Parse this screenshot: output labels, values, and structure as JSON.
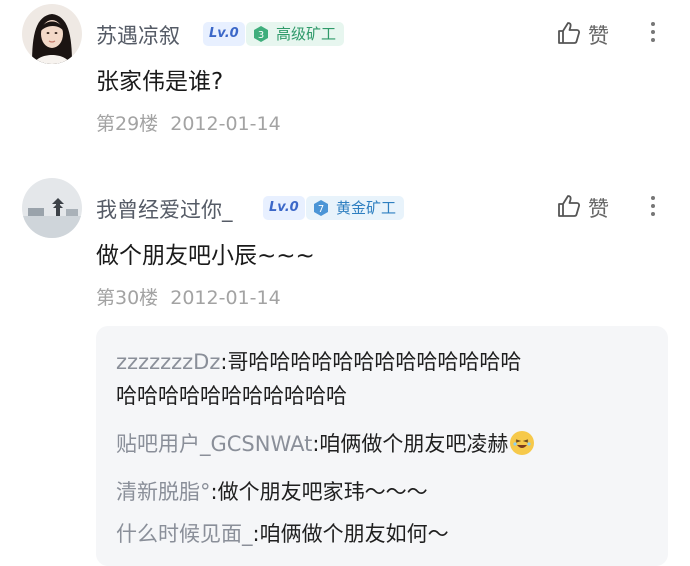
{
  "posts": [
    {
      "username": "苏遇凉叙",
      "level": "Lv.0",
      "rank_num": "3",
      "rank_title": "高级矿工",
      "like_label": "赞",
      "content": "张家伟是谁?",
      "floor": "第29楼",
      "date": "2012-01-14"
    },
    {
      "username": "我曾经爱过你_",
      "level": "Lv.0",
      "rank_num": "7",
      "rank_title": "黄金矿工",
      "like_label": "赞",
      "content": "做个朋友吧小辰~~~",
      "floor": "第30楼",
      "date": "2012-01-14"
    }
  ],
  "replies": [
    {
      "name": "zzzzzzzDz",
      "text_line1": "哥哈哈哈哈哈哈哈哈哈哈哈哈哈",
      "text_line2": "哈哈哈哈哈哈哈哈哈哈哈"
    },
    {
      "name": "贴吧用户_GCSNWAt",
      "text": "咱俩做个朋友吧凌赫",
      "emoji": "laughing-face-emoji"
    },
    {
      "name": "清新脱脂°",
      "text": "做个朋友吧家玮～～～"
    },
    {
      "name": "什么时候见面_",
      "text": "咱俩做个朋友如何～"
    }
  ],
  "separator": ":",
  "colors": {
    "rank_green": "#2f9a6a",
    "rank_blue": "#2e7fc0",
    "level_blue": "#3b67c8",
    "reply_bg": "#f5f6f8"
  }
}
